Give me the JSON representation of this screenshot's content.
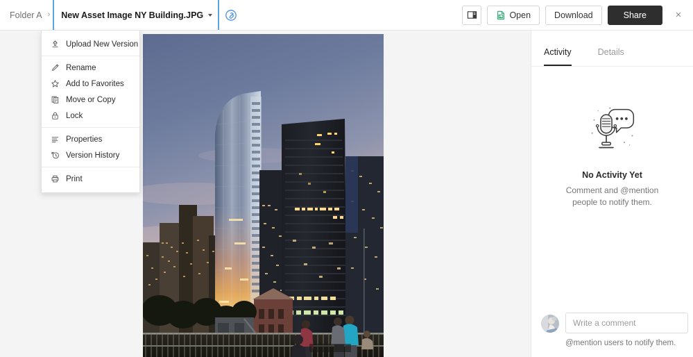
{
  "header": {
    "breadcrumb": {
      "folder_label": "Folder A",
      "separator": "›",
      "filename": "New Asset Image NY Building.JPG",
      "clip_icon": "attachment-link-icon"
    },
    "actions": {
      "sidebar_toggle_icon": "panel-toggle-icon",
      "open_label": "Open",
      "open_icon": "image-file-icon",
      "download_label": "Download",
      "share_label": "Share",
      "close_label": "×"
    }
  },
  "menu": {
    "groups": [
      {
        "items": [
          {
            "label": "Upload New Version",
            "icon": "upload-icon"
          }
        ]
      },
      {
        "items": [
          {
            "label": "Rename",
            "icon": "pencil-icon"
          },
          {
            "label": "Add to Favorites",
            "icon": "star-icon"
          },
          {
            "label": "Move or Copy",
            "icon": "copy-icon"
          },
          {
            "label": "Lock",
            "icon": "lock-icon"
          }
        ]
      },
      {
        "items": [
          {
            "label": "Properties",
            "icon": "list-lines-icon"
          },
          {
            "label": "Version History",
            "icon": "history-clock-icon"
          }
        ]
      },
      {
        "items": [
          {
            "label": "Print",
            "icon": "printer-icon"
          }
        ]
      }
    ]
  },
  "preview": {
    "file_type": "image",
    "alt": "Photograph of New York City skyscrapers at dusk with a curved glass tower, a dark rectangular tower, a park with trees and people at a railing in the foreground"
  },
  "sidebar": {
    "tabs": [
      {
        "label": "Activity",
        "active": true
      },
      {
        "label": "Details",
        "active": false
      }
    ],
    "empty_state": {
      "illustration": "microphone-speech-bubble-icon",
      "title": "No Activity Yet",
      "subtitle": "Comment and @mention people to notify them."
    },
    "comment": {
      "avatar_icon": "user-avatar",
      "placeholder": "Write a comment",
      "value": "",
      "hint": "@mention users to notify them."
    }
  },
  "colors": {
    "accent_blue": "#5aa4e8",
    "share_dark": "#2e2e2e",
    "open_green": "#26a96c",
    "preview_bg": "#f4f4f4",
    "border": "#e8e8e8"
  }
}
